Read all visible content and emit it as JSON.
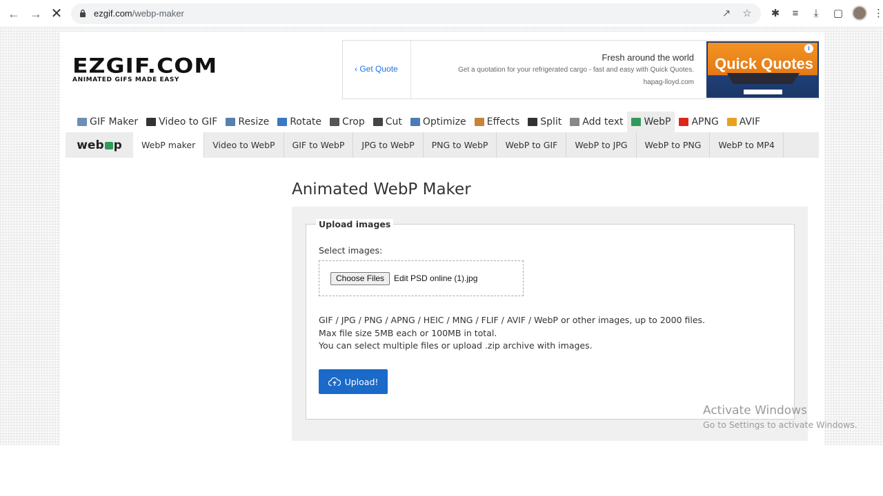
{
  "browser": {
    "url_domain": "ezgif.com",
    "url_path": "/webp-maker",
    "nav_icons": [
      "back-icon",
      "forward-icon",
      "stop-icon"
    ],
    "right_icons": [
      "share-icon",
      "star-icon",
      "extensions-icon",
      "reading-list-icon",
      "download-icon",
      "side-panel-icon"
    ]
  },
  "header": {
    "logo_main": "EZGIF.COM",
    "logo_sub": "ANIMATED GIFS MADE EASY"
  },
  "ad": {
    "quote_link": "Get Quote",
    "headline": "Fresh around the world",
    "body": "Get a quotation for your refrigerated cargo - fast and easy with Quick Quotes.",
    "domain": "hapag-lloyd.com",
    "banner_title": "Quick Quotes",
    "colors": {
      "orange": "#f39322",
      "navy": "#1d3a73"
    }
  },
  "toolbar": {
    "items": [
      {
        "label": "GIF Maker",
        "icon": "gif-maker-icon",
        "color": "#6c8fb5"
      },
      {
        "label": "Video to GIF",
        "icon": "film-icon",
        "color": "#333333"
      },
      {
        "label": "Resize",
        "icon": "resize-icon",
        "color": "#5580b0"
      },
      {
        "label": "Rotate",
        "icon": "rotate-icon",
        "color": "#3a78c2"
      },
      {
        "label": "Crop",
        "icon": "crop-icon",
        "color": "#555555"
      },
      {
        "label": "Cut",
        "icon": "cut-icon",
        "color": "#444444"
      },
      {
        "label": "Optimize",
        "icon": "optimize-icon",
        "color": "#4c7bb5"
      },
      {
        "label": "Effects",
        "icon": "effects-icon",
        "color": "#c5843a"
      },
      {
        "label": "Split",
        "icon": "split-icon",
        "color": "#333333"
      },
      {
        "label": "Add text",
        "icon": "add-text-icon",
        "color": "#888888"
      },
      {
        "label": "WebP",
        "icon": "webp-icon",
        "color": "#2f9a5a"
      },
      {
        "label": "APNG",
        "icon": "apng-icon",
        "color": "#e0251b"
      },
      {
        "label": "AVIF",
        "icon": "avif-icon",
        "color": "#e8a21f"
      }
    ]
  },
  "subnav": {
    "logo_text_left": "web",
    "logo_text_right": "p",
    "tabs": [
      "WebP maker",
      "Video to WebP",
      "GIF to WebP",
      "JPG to WebP",
      "PNG to WebP",
      "WebP to GIF",
      "WebP to JPG",
      "WebP to PNG",
      "WebP to MP4"
    ]
  },
  "main": {
    "title": "Animated WebP Maker",
    "legend": "Upload images",
    "select_label": "Select images:",
    "choose_button": "Choose Files",
    "file_name": "Edit PSD online (1).jpg",
    "info_lines": [
      "GIF / JPG / PNG / APNG / HEIC / MNG / FLIF / AVIF / WebP or other images, up to 2000 files.",
      "Max file size 5MB each or 100MB in total.",
      "You can select multiple files or upload .zip archive with images."
    ],
    "upload_button": "Upload!",
    "accent": "#1b6ac9"
  },
  "watermark": {
    "line1": "Activate Windows",
    "line2": "Go to Settings to activate Windows."
  }
}
